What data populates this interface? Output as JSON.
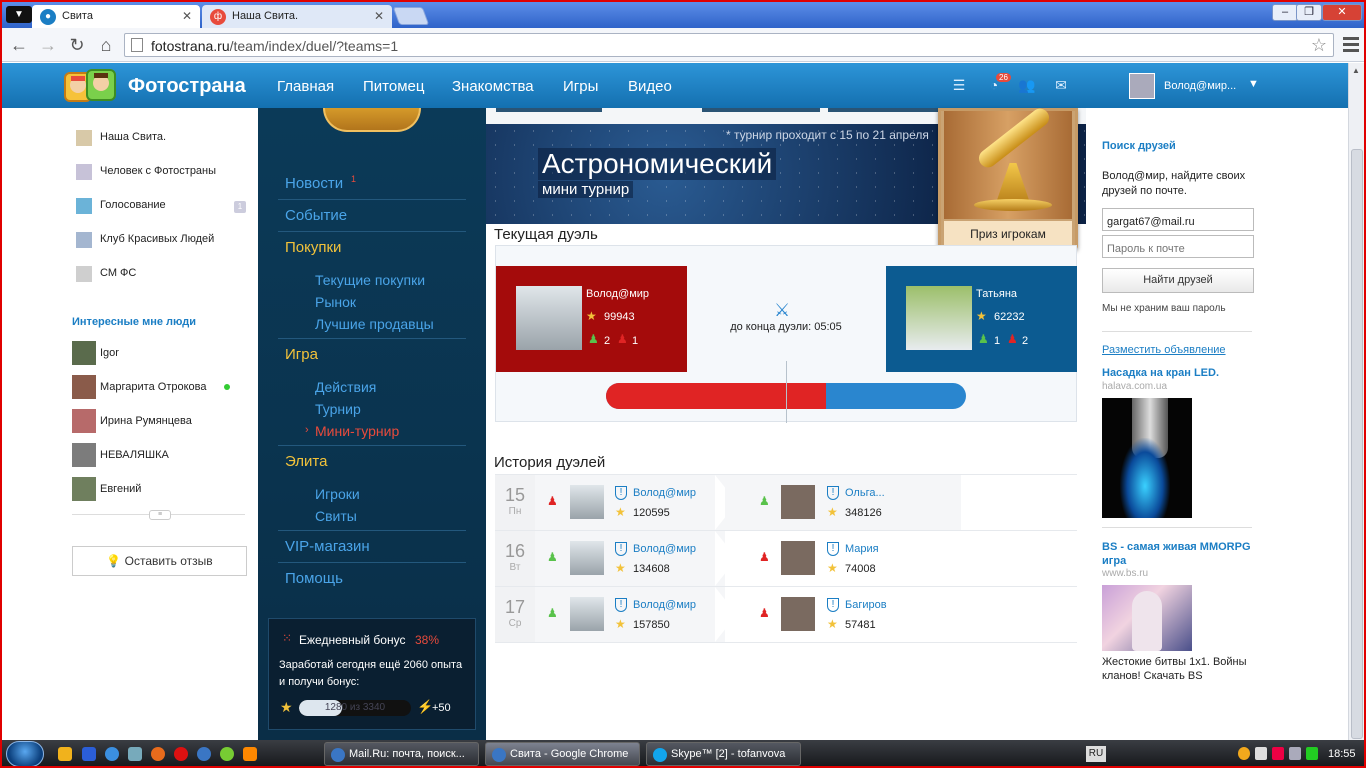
{
  "browser": {
    "tabs": [
      {
        "title": "Свита",
        "active": true
      },
      {
        "title": "Наша Свита.",
        "active": false
      }
    ],
    "url_domain": "fotostrana.ru",
    "url_path": "/team/index/duel/?teams=1"
  },
  "header": {
    "logo_text": "Фотострана",
    "nav": [
      "Главная",
      "Питомец",
      "Знакомства",
      "Игры",
      "Видео"
    ],
    "notification_count": "26",
    "user_name": "Волод@мир..."
  },
  "left": {
    "groups": [
      {
        "name": "Наша Свита.",
        "count": ""
      },
      {
        "name": "Человек с Фотостраны",
        "count": ""
      },
      {
        "name": "Голосование",
        "count": "1"
      },
      {
        "name": "Клуб Красивых Людей",
        "count": ""
      },
      {
        "name": "СМ ФС",
        "count": ""
      }
    ],
    "people_title": "Интересные мне люди",
    "people": [
      "Igor",
      "Маргарита Отрокова",
      "Ирина Румянцева",
      "НЕВАЛЯШКА",
      "Евгений"
    ],
    "feedback_label": "Оставить отзыв"
  },
  "darknav": {
    "news": "Новости",
    "news_count": "1",
    "event": "Событие",
    "purchases": "Покупки",
    "purchases_sub": [
      "Текущие покупки",
      "Рынок",
      "Лучшие продавцы"
    ],
    "game": "Игра",
    "game_sub": [
      "Действия",
      "Турнир",
      "Мини-турнир"
    ],
    "elite": "Элита",
    "elite_sub": [
      "Игроки",
      "Свиты"
    ],
    "vip": "VIP-магазин",
    "help": "Помощь",
    "bonus": {
      "title": "Ежедневный бонус",
      "percent": "38%",
      "desc": "Заработай сегодня ещё 2060 опыта и получи бонус:",
      "progress_text": "1280 из 3340",
      "progress_fraction": 0.383,
      "reward": "+50"
    }
  },
  "main": {
    "banner": {
      "dates": "* турнир проходит с 15 по 21 апреля",
      "title": "Астрономический",
      "subtitle": "мини турнир"
    },
    "prize_label": "Приз игрокам",
    "duel_title": "Текущая дуэль",
    "duel": {
      "left": {
        "name": "Волод@мир",
        "score": "99943",
        "wins": "2",
        "losses": "1"
      },
      "right": {
        "name": "Татьяна",
        "score": "62232",
        "wins": "1",
        "losses": "2"
      },
      "timer": "до конца дуэли: 05:05",
      "left_share": 0.61
    },
    "history_title": "История дуэлей",
    "history": [
      {
        "day": "15",
        "weekday": "Пн",
        "left_result": "loss",
        "left_name": "Волод@мир",
        "left_score": "120595",
        "right_result": "win",
        "right_name": "Ольга...",
        "right_score": "348126"
      },
      {
        "day": "16",
        "weekday": "Вт",
        "left_result": "win",
        "left_name": "Волод@мир",
        "left_score": "134608",
        "right_result": "loss",
        "right_name": "Мария",
        "right_score": "74008"
      },
      {
        "day": "17",
        "weekday": "Ср",
        "left_result": "win",
        "left_name": "Волод@мир",
        "left_score": "157850",
        "right_result": "loss",
        "right_name": "Багиров",
        "right_score": "57481"
      }
    ]
  },
  "right": {
    "title": "Поиск друзей",
    "desc": "Волод@мир, найдите своих друзей по почте.",
    "email_value": "gargat67@mail.ru",
    "password_placeholder": "Пароль к почте",
    "find_button": "Найти друзей",
    "note": "Мы не храним ваш пароль",
    "ad_link": "Разместить объявление",
    "ads": [
      {
        "title": "Насадка на кран LED.",
        "domain": "halava.com.ua"
      },
      {
        "title": "BS - самая живая MMORPG игра",
        "domain": "www.bs.ru",
        "desc": "Жестокие битвы 1x1. Войны кланов! Скачать BS"
      }
    ]
  },
  "taskbar": {
    "tasks": [
      "Mail.Ru: почта, поиск...",
      "Свита - Google Chrome",
      "Skype™ [2] - tofanvova"
    ],
    "lang": "RU",
    "clock": "18:55"
  },
  "colors": {
    "header_blue": "#1b7ec4",
    "dark_nav": "#0b3a58",
    "duel_red": "#a40b0b",
    "duel_blue": "#0c5b91",
    "accent_red": "#e84b3c",
    "nav_yellow": "#f2c23a"
  }
}
